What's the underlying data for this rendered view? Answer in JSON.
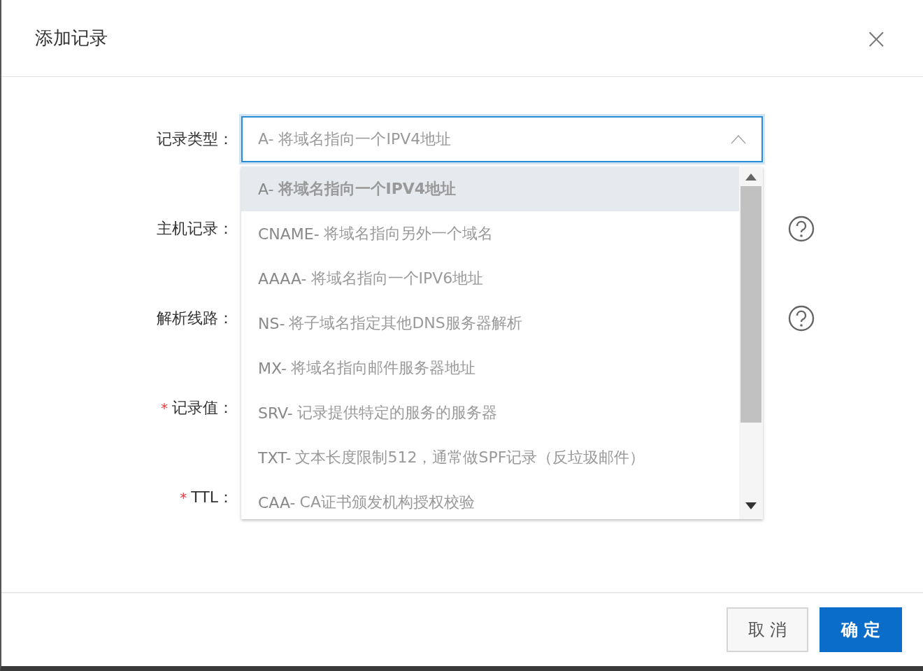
{
  "dialog": {
    "title": "添加记录",
    "close_symbol": "×"
  },
  "form": {
    "rows": [
      {
        "label": "记录类型：",
        "required": false,
        "help": false
      },
      {
        "label": "主机记录：",
        "required": false,
        "help": true
      },
      {
        "label": "解析线路：",
        "required": false,
        "help": true
      },
      {
        "label": "记录值：",
        "required": true,
        "help": false
      },
      {
        "label": "TTL：",
        "required": true,
        "help": false
      }
    ],
    "required_mark": "*",
    "record_type_select": {
      "value": "A- 将域名指向一个IPV4地址",
      "expanded": true,
      "options": [
        {
          "code": "A-",
          "text": "将域名指向一个IPV4地址",
          "selected": true
        },
        {
          "code": "CNAME-",
          "text": "将域名指向另外一个域名",
          "selected": false
        },
        {
          "code": "AAAA-",
          "text": "将域名指向一个IPV6地址",
          "selected": false
        },
        {
          "code": "NS-",
          "text": "将子域名指定其他DNS服务器解析",
          "selected": false
        },
        {
          "code": "MX-",
          "text": "将域名指向邮件服务器地址",
          "selected": false
        },
        {
          "code": "SRV-",
          "text": "记录提供特定的服务的服务器",
          "selected": false
        },
        {
          "code": "TXT-",
          "text": "文本长度限制512，通常做SPF记录（反垃圾邮件）",
          "selected": false
        },
        {
          "code": "CAA-",
          "text": "CA证书颁发机构授权校验",
          "selected": false
        }
      ]
    }
  },
  "buttons": [
    {
      "label": "取 消",
      "kind": "default"
    },
    {
      "label": "确 定",
      "kind": "primary"
    }
  ]
}
